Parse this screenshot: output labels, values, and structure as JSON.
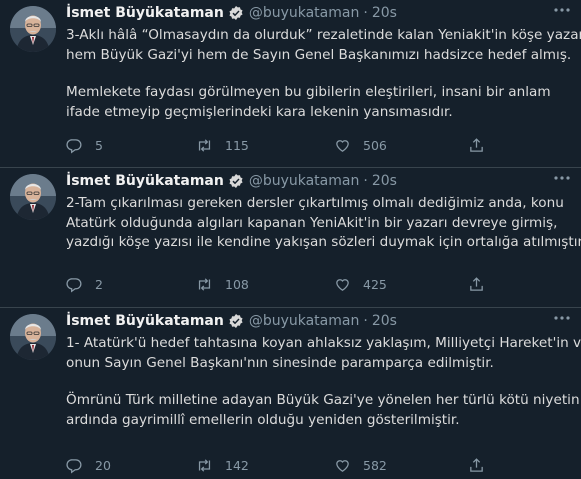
{
  "tweets": [
    {
      "author_name": "İsmet Büyükataman",
      "author_handle": "@buyukataman",
      "separator": "·",
      "time": "20s",
      "paragraphs": [
        [
          "3-Aklı hâlâ “Olmasaydın da olurduk” rezaletinde kalan Yeniakit'in köşe yazarı",
          "hem Büyük Gazi'yi hem de Sayın Genel Başkanımızı hadsizce hedef almış."
        ],
        [
          "Memlekete faydası görülmeyen bu gibilerin eleştirileri, insani bir anlam",
          "ifade etmeyip geçmişlerindeki kara lekenin yansımasıdır."
        ]
      ],
      "replies": "5",
      "retweets": "115",
      "likes": "506"
    },
    {
      "author_name": "İsmet Büyükataman",
      "author_handle": "@buyukataman",
      "separator": "·",
      "time": "20s",
      "paragraphs": [
        [
          "2-Tam çıkarılması gereken dersler çıkartılmış olmalı dediğimiz anda, konu",
          "Atatürk olduğunda algıları kapanan YeniAkit'in bir yazarı devreye girmiş,",
          "yazdığı köşe yazısı ile kendine yakışan sözleri duymak için ortalığa atılmıştır."
        ]
      ],
      "replies": "2",
      "retweets": "108",
      "likes": "425"
    },
    {
      "author_name": "İsmet Büyükataman",
      "author_handle": "@buyukataman",
      "separator": "·",
      "time": "20s",
      "paragraphs": [
        [
          "1- Atatürk'ü hedef tahtasına koyan ahlaksız yaklaşım, Milliyetçi Hareket'in ve",
          "onun Sayın Genel Başkanı'nın sinesinde paramparça edilmiştir."
        ],
        [
          "Ömrünü Türk milletine adayan Büyük Gazi'ye yönelen her türlü kötü niyetin",
          "ardında gayrimillî emellerin olduğu yeniden gösterilmiştir."
        ]
      ],
      "replies": "20",
      "retweets": "142",
      "likes": "582"
    }
  ],
  "icons": {
    "reply": "reply-icon",
    "retweet": "retweet-icon",
    "like": "like-icon",
    "share": "share-icon",
    "verified": "verified-badge-icon",
    "more": "more-icon"
  },
  "colors": {
    "background": "#15202b",
    "divider": "#38444d",
    "secondary_text": "#8899a6",
    "verified": "#1da1f2"
  }
}
